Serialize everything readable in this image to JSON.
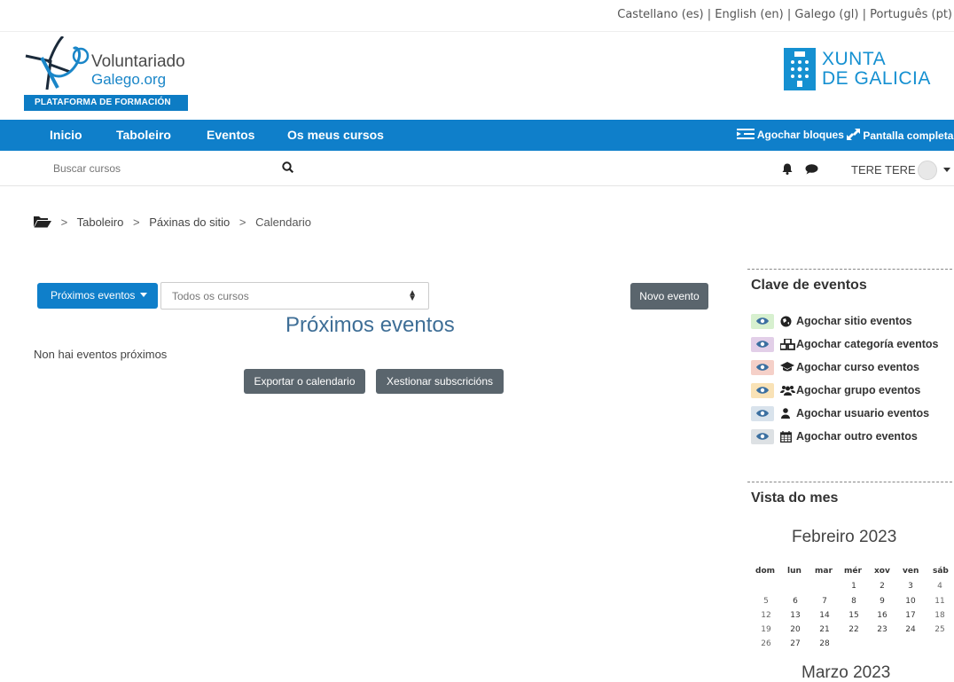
{
  "languages": {
    "es": "Castellano (es)",
    "en": "English (en)",
    "gl": "Galego (gl)",
    "pt": "Português (pt)",
    "separator": "|"
  },
  "brand": {
    "left_line1": "Voluntariado",
    "left_line2": "Galego.org",
    "left_banner": "PLATAFORMA DE FORMACIÓN",
    "right_line1": "XUNTA",
    "right_line2": "DE GALICIA",
    "brand_color": "#0f7fca"
  },
  "nav": {
    "home": "Inicio",
    "dashboard": "Taboleiro",
    "events": "Eventos",
    "my_courses": "Os meus cursos",
    "hide_blocks": "Agochar bloques",
    "fullscreen": "Pantalla completa"
  },
  "search": {
    "placeholder": "Buscar cursos"
  },
  "user": {
    "name": "TERE TERE"
  },
  "breadcrumb": {
    "items": [
      "Taboleiro",
      "Páxinas do sitio",
      "Calendario"
    ],
    "separator": ">"
  },
  "toolbar": {
    "view_button": "Próximos eventos",
    "course_select_value": "Todos os cursos",
    "new_event": "Novo evento"
  },
  "main": {
    "title": "Próximos eventos",
    "empty_text": "Non hai eventos próximos",
    "export_button": "Exportar o calendario",
    "subscriptions_button": "Xestionar subscricións"
  },
  "event_key": {
    "title": "Clave de eventos",
    "items": [
      {
        "label": "Agochar sitio eventos",
        "color": "#d7f0cf",
        "icon": "globe-icon"
      },
      {
        "label": "Agochar categoría eventos",
        "color": "#e2cfe8",
        "icon": "cubes-icon"
      },
      {
        "label": "Agochar curso eventos",
        "color": "#f5d0c8",
        "icon": "graduation-cap-icon"
      },
      {
        "label": "Agochar grupo eventos",
        "color": "#f9e2b6",
        "icon": "users-icon"
      },
      {
        "label": "Agochar usuario eventos",
        "color": "#d9e3ec",
        "icon": "user-icon"
      },
      {
        "label": "Agochar outro eventos",
        "color": "#dde1e4",
        "icon": "calendar-icon"
      }
    ]
  },
  "month_view": {
    "title": "Vista do mes",
    "month1": "Febreiro 2023",
    "month2": "Marzo 2023",
    "weekdays": [
      "dom",
      "lun",
      "mar",
      "mér",
      "xov",
      "ven",
      "sáb"
    ],
    "weeks": [
      [
        "",
        "",
        "",
        "1",
        "2",
        "3",
        "4"
      ],
      [
        "5",
        "6",
        "7",
        "8",
        "9",
        "10",
        "11"
      ],
      [
        "12",
        "13",
        "14",
        "15",
        "16",
        "17",
        "18"
      ],
      [
        "19",
        "20",
        "21",
        "22",
        "23",
        "24",
        "25"
      ],
      [
        "26",
        "27",
        "28",
        "",
        "",
        "",
        ""
      ]
    ]
  }
}
